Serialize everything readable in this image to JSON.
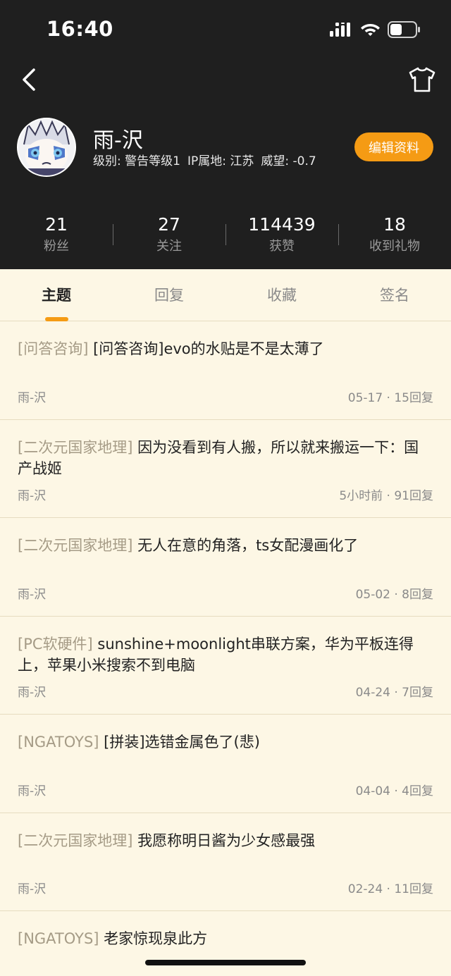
{
  "status_bar": {
    "time": "16:40"
  },
  "profile": {
    "username": "雨-沢",
    "level": "级别: 警告等级1",
    "ip_location": "IP属地: 江苏",
    "prestige": "威望: -0.7",
    "edit_label": "编辑资料"
  },
  "stats": [
    {
      "value": "21",
      "label": "粉丝"
    },
    {
      "value": "27",
      "label": "关注"
    },
    {
      "value": "114439",
      "label": "获赞"
    },
    {
      "value": "18",
      "label": "收到礼物"
    }
  ],
  "tabs": [
    "主题",
    "回复",
    "收藏",
    "签名"
  ],
  "topics": [
    {
      "category": "[问答咨询]",
      "title": "[问答咨询]evo的水贴是不是太薄了",
      "author": "雨-沢",
      "meta": "05-17 · 15回复"
    },
    {
      "category": "[二次元国家地理]",
      "title": "因为没看到有人搬，所以就来搬运一下：国产战姬",
      "author": "雨-沢",
      "meta": "5小时前 · 91回复"
    },
    {
      "category": "[二次元国家地理]",
      "title": "无人在意的角落，ts女配漫画化了",
      "author": "雨-沢",
      "meta": "05-02 · 8回复"
    },
    {
      "category": "[PC软硬件]",
      "title": "sunshine+moonlight串联方案，华为平板连得上，苹果小米搜索不到电脑",
      "author": "雨-沢",
      "meta": "04-24 · 7回复"
    },
    {
      "category": "[NGATOYS]",
      "title": "[拼装]选错金属色了(悲)",
      "author": "雨-沢",
      "meta": "04-04 · 4回复"
    },
    {
      "category": "[二次元国家地理]",
      "title": "我愿称明日酱为少女感最强",
      "author": "雨-沢",
      "meta": "02-24 · 11回复"
    },
    {
      "category": "[NGATOYS]",
      "title": "老家惊现泉此方",
      "author": "",
      "meta": ""
    }
  ],
  "colors": {
    "accent": "#f59b14",
    "header_bg": "#1f1f1f",
    "page_bg": "#fdf7e5"
  }
}
